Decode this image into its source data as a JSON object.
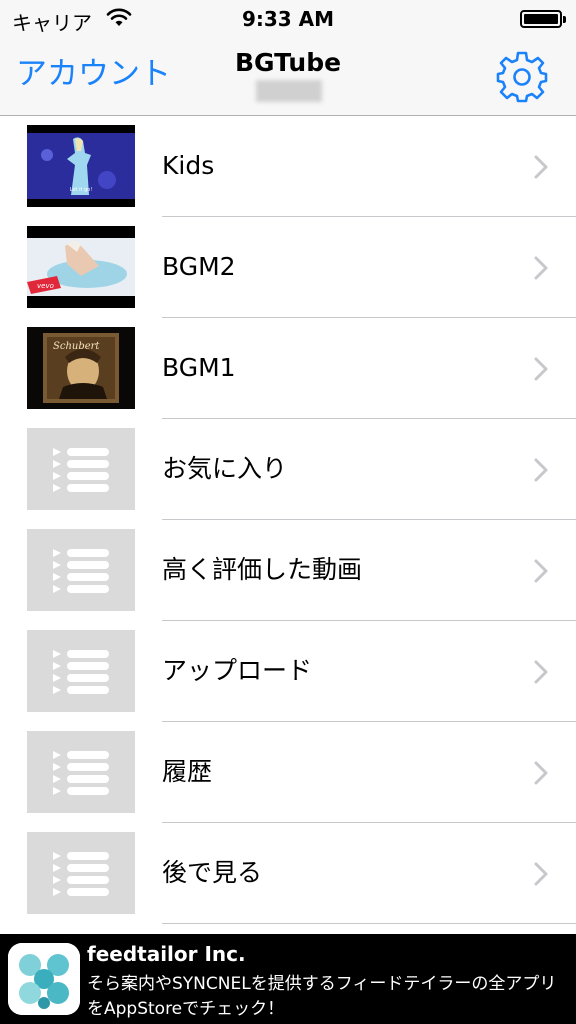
{
  "status_bar": {
    "carrier": "キャリア",
    "time": "9:33 AM"
  },
  "nav": {
    "left_button": "アカウント",
    "title": "BGTube",
    "settings_icon": "gear-icon"
  },
  "list": {
    "items": [
      {
        "label": "Kids",
        "thumbnail": "video-thumbnail"
      },
      {
        "label": "BGM2",
        "thumbnail": "video-thumbnail"
      },
      {
        "label": "BGM1",
        "thumbnail": "video-thumbnail"
      },
      {
        "label": "お気に入り",
        "thumbnail": "playlist-icon"
      },
      {
        "label": "高く評価した動画",
        "thumbnail": "playlist-icon"
      },
      {
        "label": "アップロード",
        "thumbnail": "playlist-icon"
      },
      {
        "label": "履歴",
        "thumbnail": "playlist-icon"
      },
      {
        "label": "後で見る",
        "thumbnail": "playlist-icon"
      }
    ]
  },
  "ad": {
    "title": "feedtailor Inc.",
    "text": "そら案内やSYNCNELを提供するフィードテイラーの全アプリをAppStoreでチェック！"
  },
  "colors": {
    "accent": "#1a82fb",
    "separator": "#c8c7cc",
    "chevron": "#c7c7cc",
    "placeholder": "#dadada"
  }
}
